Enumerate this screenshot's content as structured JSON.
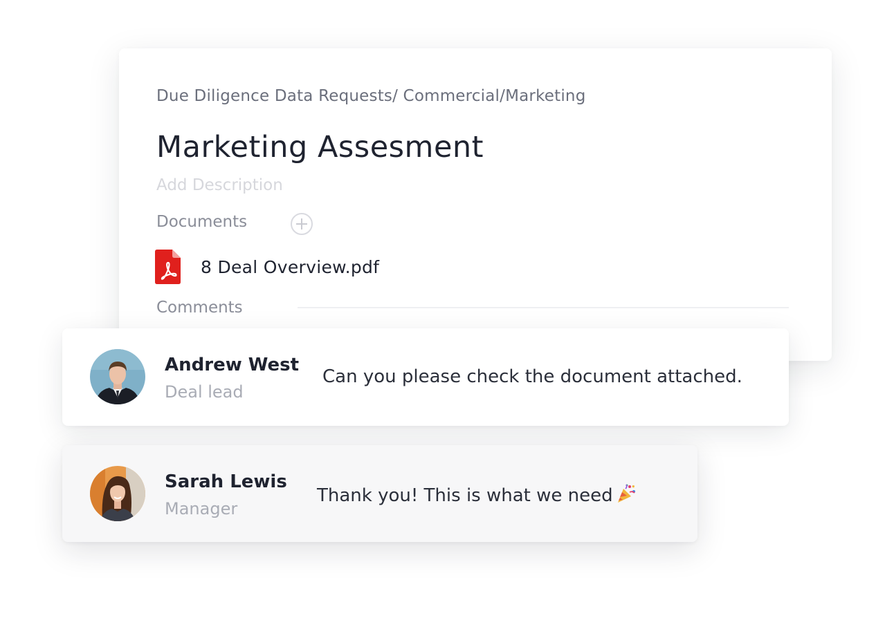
{
  "task": {
    "breadcrumb": "Due Diligence Data Requests/ Commercial/Marketing",
    "title": "Marketing Assesment",
    "description_placeholder": "Add Description",
    "documents_label": "Documents",
    "add_document_icon": "plus-circle-icon",
    "documents": [
      {
        "icon": "pdf-icon",
        "name": "8 Deal Overview.pdf"
      }
    ],
    "comments_label": "Comments"
  },
  "comments": [
    {
      "author": "Andrew West",
      "role": "Deal lead",
      "message": "Can you please check the document attached."
    },
    {
      "author": "Sarah Lewis",
      "role": "Manager",
      "message": "Thank you! This is what we need",
      "emoji": "party-popper-icon"
    }
  ],
  "colors": {
    "pdf_red": "#e0201d",
    "text_dark": "#1f2330",
    "text_muted": "#8a8d98",
    "placeholder": "#d6d7dc"
  }
}
